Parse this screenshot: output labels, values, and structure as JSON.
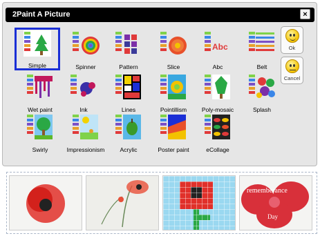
{
  "dialog": {
    "title": "2Paint A Picture",
    "close_label": "×"
  },
  "tiles": [
    {
      "label": "Simple",
      "icon": "simple-icon",
      "selected": true
    },
    {
      "label": "Spinner",
      "icon": "spinner-icon"
    },
    {
      "label": "Pattern",
      "icon": "pattern-icon"
    },
    {
      "label": "Slice",
      "icon": "slice-icon"
    },
    {
      "label": "Abc",
      "icon": "abc-icon"
    },
    {
      "label": "Belt",
      "icon": "belt-icon"
    },
    {
      "label": "Wet paint",
      "icon": "wet-paint-icon"
    },
    {
      "label": "Ink",
      "icon": "ink-icon"
    },
    {
      "label": "Lines",
      "icon": "lines-icon"
    },
    {
      "label": "Pointillism",
      "icon": "pointillism-icon"
    },
    {
      "label": "Poly-mosaic",
      "icon": "poly-mosaic-icon"
    },
    {
      "label": "Splash",
      "icon": "splash-icon"
    },
    {
      "label": "Swirly",
      "icon": "swirly-icon"
    },
    {
      "label": "Impressionism",
      "icon": "impressionism-icon"
    },
    {
      "label": "Acrylic",
      "icon": "acrylic-icon"
    },
    {
      "label": "Poster paint",
      "icon": "poster-paint-icon"
    },
    {
      "label": "eCollage",
      "icon": "ecollage-icon"
    }
  ],
  "buttons": {
    "ok_label": "Ok",
    "cancel_label": "Cancel"
  },
  "abc_text": "Abc",
  "gallery": {
    "thumbnails": [
      {
        "name": "poppy-painting-thumbnail"
      },
      {
        "name": "poppy-sketch-thumbnail"
      },
      {
        "name": "pixel-poppy-thumbnail"
      },
      {
        "name": "remembrance-day-thumbnail",
        "text_line1": "rememberance",
        "text_line2": "Day"
      }
    ]
  },
  "colors": {
    "title_bar": "#000000",
    "dialog_bg": "#e6e6e6",
    "selection_border": "#1a2fd6"
  }
}
